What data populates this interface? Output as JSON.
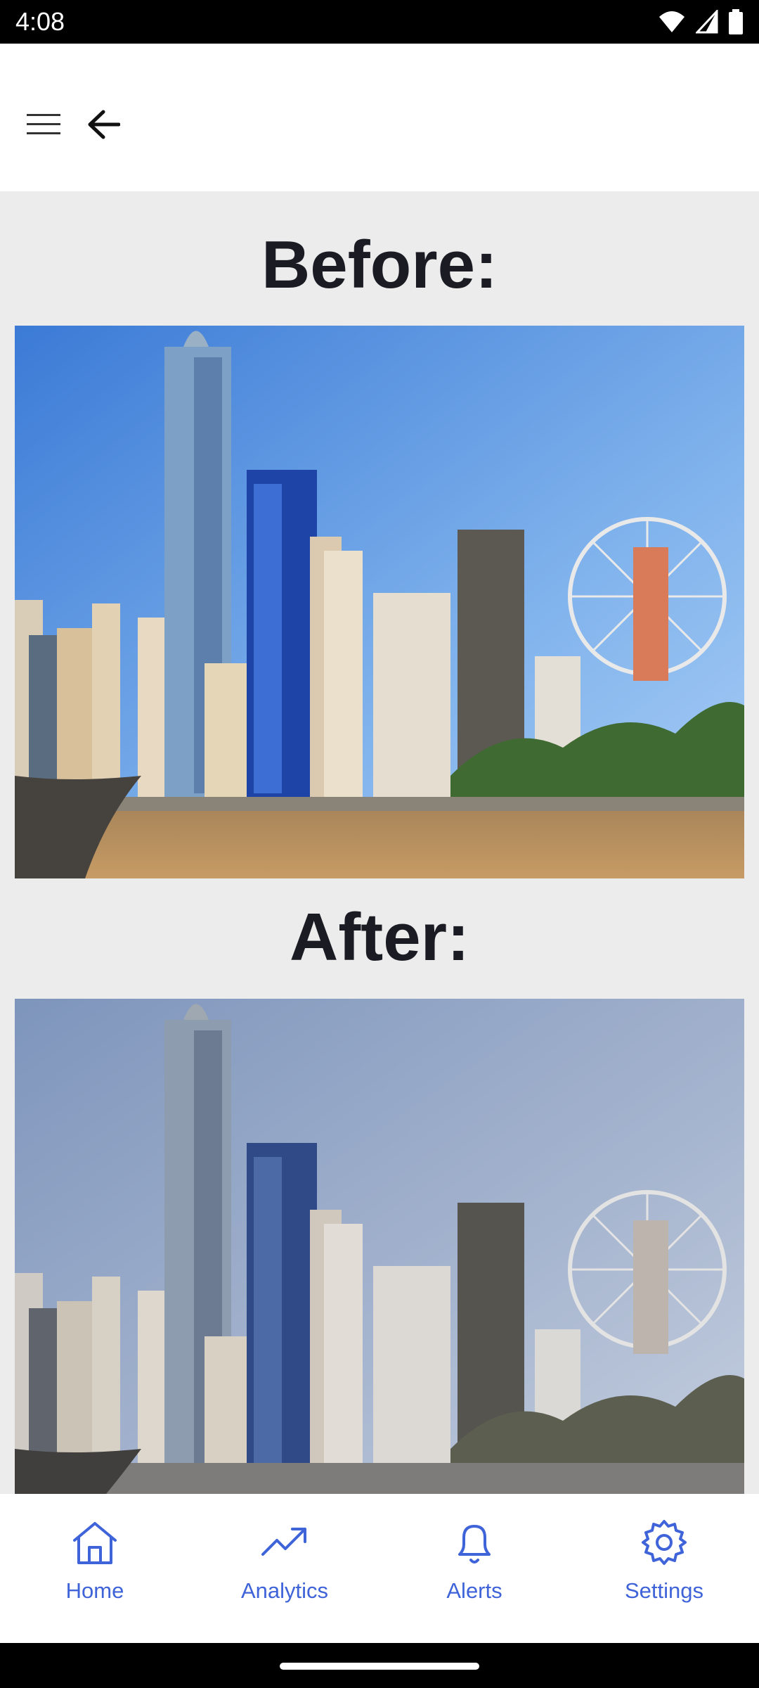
{
  "status_bar": {
    "time": "4:08"
  },
  "navigation": {
    "menu_icon": "menu-icon",
    "back_icon": "arrow-left-icon"
  },
  "comparison": {
    "before_title": "Before:",
    "after_title": "After:",
    "before_image": "city skyline with ferris wheel (vivid colors)",
    "after_image": "city skyline with ferris wheel (desaturated colors)"
  },
  "bottom_nav": {
    "items": [
      {
        "label": "Home",
        "icon": "home-icon"
      },
      {
        "label": "Analytics",
        "icon": "trending-up-icon"
      },
      {
        "label": "Alerts",
        "icon": "bell-icon"
      },
      {
        "label": "Settings",
        "icon": "gear-icon"
      }
    ]
  },
  "colors": {
    "accent": "#3f63d8",
    "background": "#ececec",
    "heading": "#1b1b24"
  }
}
